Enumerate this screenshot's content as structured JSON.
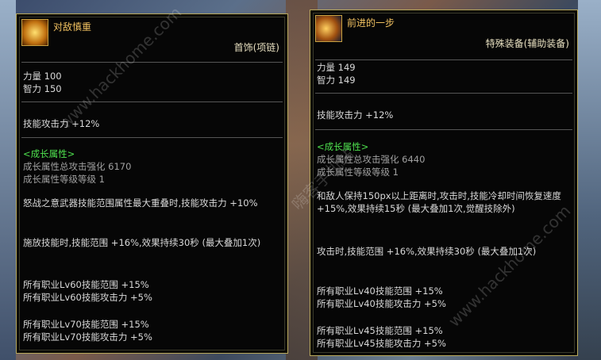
{
  "left": {
    "title": "对敌慎重",
    "type": "首饰(项链)",
    "stats": [
      "力量 100",
      "智力 150"
    ],
    "skill_atk": "技能攻击力 +12%",
    "growth_header": "<成长属性>",
    "growth": [
      "成长属性总攻击强化 6170",
      "成长属性等级等级 1"
    ],
    "effects": [
      "怒战之意武器技能范围属性最大重叠时,技能攻击力 +10%",
      "施放技能时,技能范围 +16%,效果持续30秒 (最大叠加1次)"
    ],
    "lv60": [
      "所有职业Lv60技能范围 +15%",
      "所有职业Lv60技能攻击力 +5%"
    ],
    "lv70": [
      "所有职业Lv70技能范围 +15%",
      "所有职业Lv70技能攻击力 +5%"
    ]
  },
  "right": {
    "title": "前进的一步",
    "type": "特殊装备(辅助装备)",
    "stats": [
      "力量 149",
      "智力 149"
    ],
    "skill_atk": "技能攻击力 +12%",
    "growth_header": "<成长属性>",
    "growth": [
      "成长属性总攻击强化 6440",
      "成长属性等级等级 1"
    ],
    "effects": [
      "和敌人保持150px以上距离时,攻击时,技能冷却时间恢复速度 +15%,效果持续15秒 (最大叠加1次,觉醒技除外)",
      "攻击时,技能范围 +16%,效果持续30秒 (最大叠加1次)"
    ],
    "lv40": [
      "所有职业Lv40技能范围 +15%",
      "所有职业Lv40技能攻击力 +5%"
    ],
    "lv45": [
      "所有职业Lv45技能范围 +15%",
      "所有职业Lv45技能攻击力 +5%"
    ]
  },
  "watermarks": [
    "www.hackhome.com",
    "嗨客手机站",
    "www.hackhome.com"
  ]
}
